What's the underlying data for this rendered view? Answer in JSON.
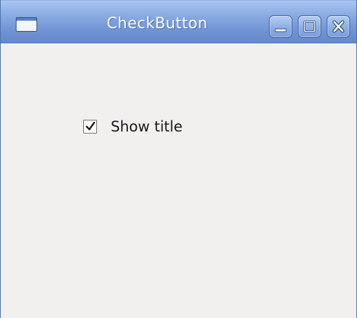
{
  "window": {
    "title": "CheckButton",
    "controls": {
      "minimize": "minimize-icon",
      "maximize": "maximize-icon",
      "close": "close-icon"
    }
  },
  "content": {
    "checkbox": {
      "label": "Show title",
      "checked": true
    }
  },
  "colors": {
    "titlebar": "#86a8e0",
    "window_bg": "#f1f0ef",
    "title_text": "#ffffff"
  }
}
